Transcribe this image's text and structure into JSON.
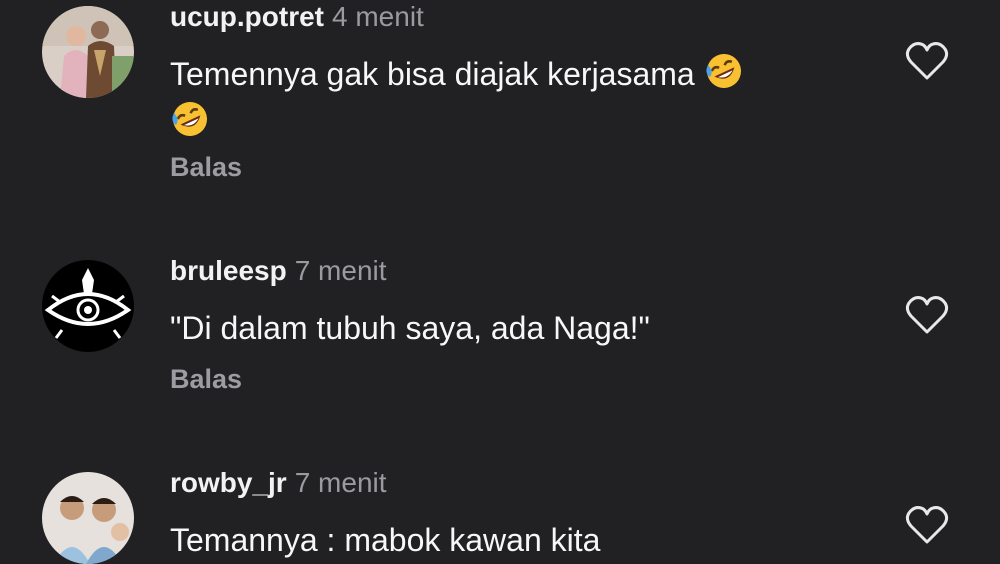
{
  "comments": [
    {
      "username": "ucup.potret",
      "time": "4 menit",
      "text": "Temennya gak bisa diajak kerjasama",
      "emoji": "rolling-on-floor-laughing",
      "reply_label": "Balas"
    },
    {
      "username": "bruleesp",
      "time": "7 menit",
      "text": "\"Di dalam tubuh saya, ada Naga!\"",
      "reply_label": "Balas"
    },
    {
      "username": "rowby_jr",
      "time": "7 menit",
      "text": "Temannya : mabok kawan kita"
    }
  ],
  "icons": {
    "like": "heart-outline-icon"
  },
  "colors": {
    "background": "#212124",
    "secondary_text": "#9a9a9f"
  }
}
